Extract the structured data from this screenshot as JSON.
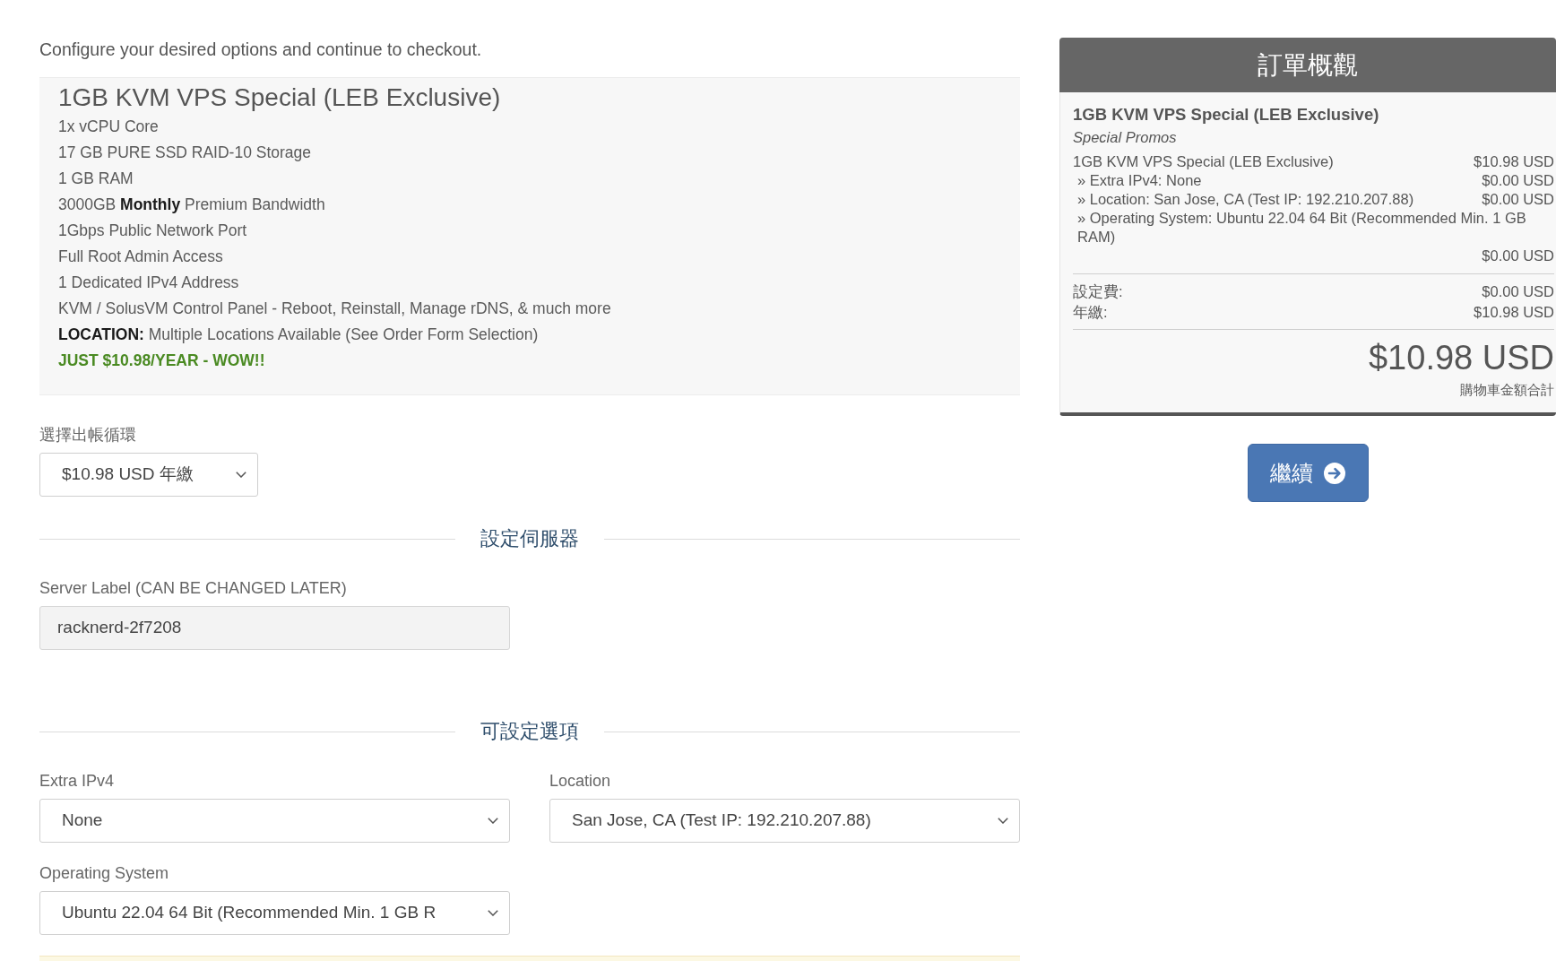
{
  "intro": "Configure your desired options and continue to checkout.",
  "product": {
    "title": "1GB KVM VPS Special (LEB Exclusive)",
    "features": [
      {
        "kind": "plain",
        "text": "1x vCPU Core"
      },
      {
        "kind": "plain",
        "text": "17 GB PURE SSD RAID-10 Storage"
      },
      {
        "kind": "plain",
        "text": "1 GB RAM"
      },
      {
        "kind": "plain",
        "text": "3000GB **Monthly** Premium Bandwidth"
      },
      {
        "kind": "plain",
        "text": "1Gbps Public Network Port"
      },
      {
        "kind": "plain",
        "text": "Full Root Admin Access"
      },
      {
        "kind": "plain",
        "text": "1 Dedicated IPv4 Address"
      },
      {
        "kind": "plain",
        "text": "KVM / SolusVM Control Panel - Reboot, Reinstall, Manage rDNS, & much more"
      },
      {
        "kind": "plain",
        "text": "**LOCATION:** Multiple Locations Available (See Order Form Selection)"
      },
      {
        "kind": "promo",
        "text": "JUST $10.98/YEAR - WOW!!"
      }
    ]
  },
  "billing_cycle": {
    "kind": "select",
    "label": "選擇出帳循環",
    "value": "$10.98 USD 年繳"
  },
  "server_config": {
    "heading": "設定伺服器",
    "fields": [
      {
        "kind": "text",
        "label": "Server Label (CAN BE CHANGED LATER)",
        "value": "racknerd-2f7208"
      }
    ]
  },
  "configurable_options": {
    "heading": "可設定選項",
    "fields": [
      {
        "kind": "select",
        "label": "Extra IPv4",
        "value": "None"
      },
      {
        "kind": "select",
        "label": "Location",
        "value": "San Jose, CA (Test IP: 192.210.207.88)"
      },
      {
        "kind": "select",
        "label": "Operating System",
        "value": "Ubuntu 22.04 64 Bit (Recommended Min. 1 GB R"
      }
    ]
  },
  "order_summary": {
    "title": "訂單概觀",
    "product_name": "1GB KVM VPS Special (LEB Exclusive)",
    "product_group": "Special Promos",
    "line_items": [
      {
        "kind": "product",
        "label": "1GB KVM VPS Special (LEB Exclusive)",
        "amount": "$10.98 USD"
      },
      {
        "kind": "option",
        "label": "» Extra IPv4: None",
        "amount": "$0.00 USD"
      },
      {
        "kind": "option",
        "label": "» Location: San Jose, CA (Test IP: 192.210.207.88)",
        "amount": "$0.00 USD"
      },
      {
        "kind": "option",
        "label": "» Operating System: Ubuntu 22.04 64 Bit (Recommended Min. 1 GB RAM)",
        "amount": "$0.00 USD"
      }
    ],
    "fees": [
      {
        "label": "設定費:",
        "amount": "$0.00 USD"
      },
      {
        "label": "年繳:",
        "amount": "$10.98 USD"
      }
    ],
    "total": "$10.98 USD",
    "total_caption": "購物車金額合計"
  },
  "continue_button": {
    "label": "繼續"
  }
}
